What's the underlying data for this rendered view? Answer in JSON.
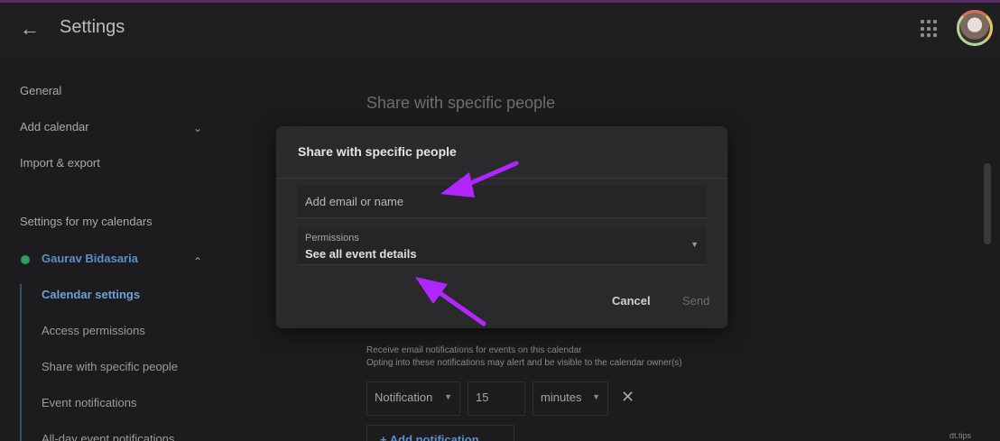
{
  "header": {
    "title": "Settings",
    "back_icon": "arrow-left-icon",
    "apps_icon": "grid-icon"
  },
  "sidebar": {
    "general": "General",
    "add_calendar": "Add calendar",
    "import_export": "Import & export",
    "section_title": "Settings for my calendars",
    "calendar_name": "Gaurav Bidasaria",
    "calendar_color": "#2f9b5e",
    "sub_items": [
      {
        "label": "Calendar settings",
        "active": true
      },
      {
        "label": "Access permissions"
      },
      {
        "label": "Share with specific people"
      },
      {
        "label": "Event notifications"
      },
      {
        "label": "All-day event notifications"
      }
    ]
  },
  "main": {
    "section_heading": "Share with specific people",
    "notification_desc_1": "Receive email notifications for events on this calendar",
    "notification_desc_2": "Opting into these notifications may alert and be visible to the calendar owner(s)",
    "notification_type": "Notification",
    "notification_value": "15",
    "notification_unit": "minutes",
    "add_notification": "Add notification"
  },
  "dialog": {
    "title": "Share with specific people",
    "email_placeholder": "Add email or name",
    "permissions_label": "Permissions",
    "permissions_value": "See all event details",
    "cancel_label": "Cancel",
    "send_label": "Send"
  },
  "annotations": {
    "arrow_color": "#b026ff"
  },
  "watermark": "dt.tips"
}
